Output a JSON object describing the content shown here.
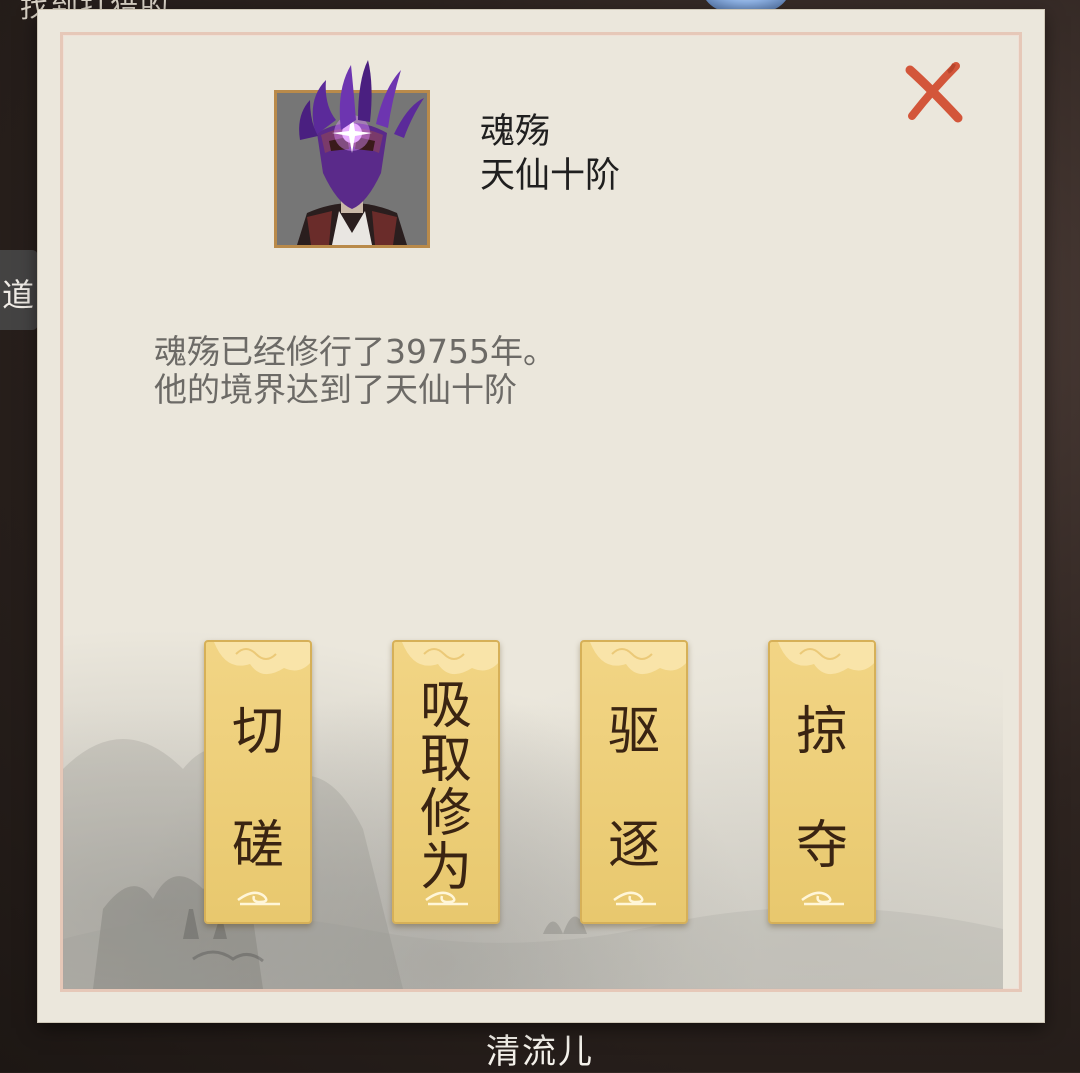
{
  "background": {
    "top_text": "找到打猎的",
    "side_label": "道",
    "bottom_name": "清流儿"
  },
  "dialog": {
    "character": {
      "name": "魂殇",
      "realm": "天仙十阶"
    },
    "description": {
      "line1": "魂殇已经修行了39755年。",
      "line2": "他的境界达到了天仙十阶"
    },
    "actions": [
      {
        "label_lines": [
          "切",
          "磋"
        ]
      },
      {
        "label_lines": [
          "吸",
          "取",
          "修",
          "为"
        ]
      },
      {
        "label_lines": [
          "驱",
          "逐"
        ]
      },
      {
        "label_lines": [
          "掠",
          "夺"
        ]
      }
    ]
  },
  "colors": {
    "dialog_bg": "#ebe7dc",
    "button_gold": "#f2d585",
    "close_red": "#d3563a",
    "text_dark": "#1f1f1f",
    "text_gray": "#6c6a66"
  },
  "icons": {
    "close": "close-x-icon",
    "portrait": "masked-character-avatar"
  }
}
